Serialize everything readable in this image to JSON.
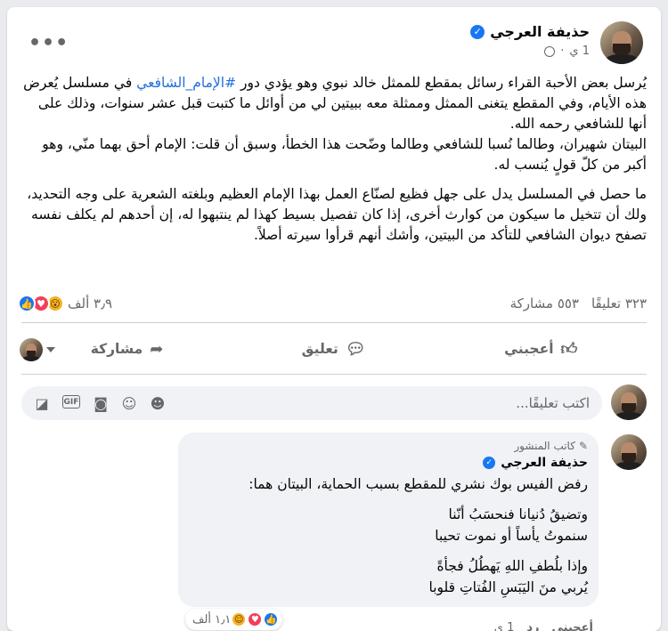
{
  "post": {
    "author": "حذيفة العرجي",
    "time": "1 ي",
    "more": "•••",
    "paragraph1_pre": "يُرسل بعض الأحبة القراء رسائل بمقطع للممثل خالد نبوي وهو يؤدي دور ",
    "hashtag": "#الإمام_الشافعي",
    "paragraph1_post": " في مسلسل يُعرض هذه الأيام، وفي المقطع يتغنى الممثل وممثلة معه ببيتين لي من أوائل ما كتبت قبل عشر سنوات، وذلك على أنها للشافعي رحمه الله.",
    "paragraph1_line2": "البيتان شهيران، وطالما نُسبا للشافعي وطالما وضّحت هذا الخطأ، وسبق أن قلت: الإمام أحق بهما منّي، وهو أكبر من كلّ قولٍ يُنسب له.",
    "paragraph2": "ما حصل في المسلسل يدل على جهل فظيع لصنّاع العمل بهذا الإمام العظيم وبلغته الشعرية على وجه التحديد، ولك أن تتخيل ما سيكون من كوارث أخرى، إذا كان تفصيل بسيط كهذا لم ينتبهوا له، إن أحدهم لم يكلف نفسه تصفح ديوان الشافعي للتأكد من البيتين، وأشك أنهم قرأوا سيرته أصلاً."
  },
  "stats": {
    "reactions_count": "٣٫٩ ألف",
    "comments": "٣٢٣ تعليقًا",
    "shares": "٥٥٣ مشاركة"
  },
  "actions": {
    "like": "أعجبني",
    "comment": "تعليق",
    "share": "مشاركة"
  },
  "comment_input": {
    "placeholder": "اكتب تعليقًا..."
  },
  "comment": {
    "author_tag": "كاتب المنشور",
    "author": "حذيفة العرجي",
    "line1": "رفض الفيس بوك نشري للمقطع بسبب الحماية، البيتان هما:",
    "verse1a": "وتضيقُ دُنيانا فنحسَبُ أنّنا",
    "verse1b": "سنموتُ يأساً أو نموت تحيبا",
    "verse2a": "وإذا بلُطفِ اللهِ يَهطُلُ فجأةً",
    "verse2b": "يُربي منَ اليَبَسِ الفُتاتِ قلوبا",
    "reactions_count": "١٫١ ألف",
    "like": "أعجبني",
    "reply": "رد",
    "time": "1 ي"
  },
  "colors": {
    "accent": "#1877f2",
    "hashtag": "#216fdb",
    "muted": "#65676b"
  }
}
